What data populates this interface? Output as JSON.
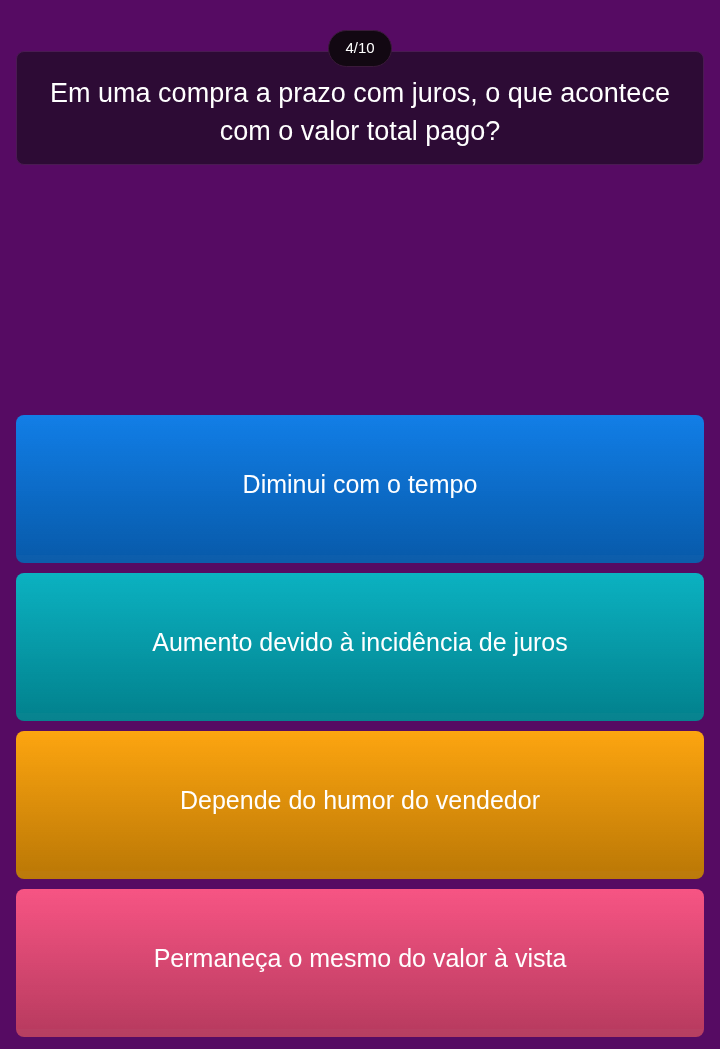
{
  "counter": "4/10",
  "question": "Em uma compra a prazo com juros, o que acontece com o valor total pago?",
  "answers": [
    {
      "text": "Diminui com o tempo",
      "color": "#0a7ae6"
    },
    {
      "text": "Aumento devido à incidência de juros",
      "color": "#03afbf"
    },
    {
      "text": "Depende do humor do vendedor",
      "color": "#fda208"
    },
    {
      "text": "Permaneça o mesmo do valor à vista",
      "color": "#f74f80"
    }
  ]
}
